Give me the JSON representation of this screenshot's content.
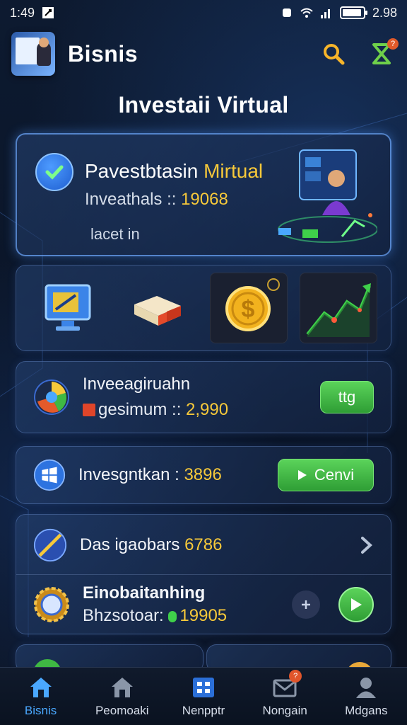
{
  "status_bar": {
    "time": "1:49",
    "battery": "2.98"
  },
  "header": {
    "app_title": "Bisnis",
    "search_icon": "search-icon",
    "hourglass_icon": "hourglass-icon",
    "notification_badge": "?"
  },
  "page": {
    "title": "Investaii Virtual"
  },
  "hero": {
    "title_part1": "Pavestbtasin ",
    "title_accent": "Mirtual",
    "sub_label": "Inveathals :: ",
    "sub_value": "19068",
    "link_text": "lacet in"
  },
  "icon_tiles": [
    {
      "name": "monitor-icon"
    },
    {
      "name": "eraser-icon"
    },
    {
      "name": "dollar-coin-icon"
    },
    {
      "name": "growth-chart-icon"
    }
  ],
  "card_invest": {
    "title": "Inveeagiruahn",
    "sub_label": "gesimum :: ",
    "sub_value": "2,990",
    "button_label": "ttg"
  },
  "card_invest2": {
    "label": "Invesgntkan : ",
    "value": "3896",
    "button_label": "Cenvi"
  },
  "card_list": {
    "row1_label": "Das igaobars ",
    "row1_value": "6786",
    "row2_title": "Einobaitanhing",
    "row2_sub_label": "Bhzsotoar: ",
    "row2_sub_value": "19905"
  },
  "bottom_nav": [
    {
      "label": "Bisnis",
      "icon": "home-icon",
      "active": true
    },
    {
      "label": "Peomoaki",
      "icon": "house-icon",
      "active": false
    },
    {
      "label": "Nenpptr",
      "icon": "grid-icon",
      "active": false
    },
    {
      "label": "Nongain",
      "icon": "mail-icon",
      "active": false,
      "badge": "?"
    },
    {
      "label": "Mdgans",
      "icon": "user-icon",
      "active": false
    }
  ],
  "colors": {
    "accent_gold": "#f7c93a",
    "accent_blue": "#4aa8ff",
    "button_green": "#3fb843",
    "background": "#0b1424"
  }
}
